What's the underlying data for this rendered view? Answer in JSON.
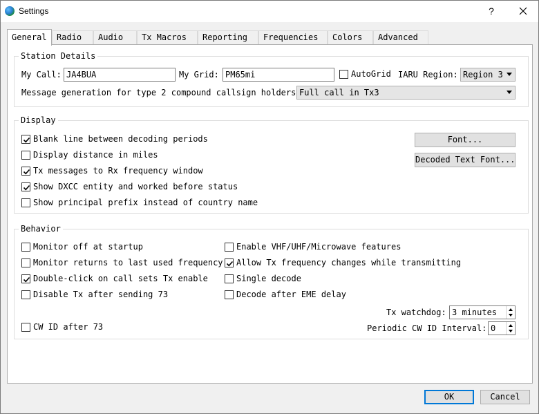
{
  "window": {
    "title": "Settings",
    "help_label": "?"
  },
  "tabs": [
    {
      "label": "General"
    },
    {
      "label": "Radio"
    },
    {
      "label": "Audio"
    },
    {
      "label": "Tx Macros"
    },
    {
      "label": "Reporting"
    },
    {
      "label": "Frequencies"
    },
    {
      "label": "Colors"
    },
    {
      "label": "Advanced"
    }
  ],
  "active_tab": "General",
  "station": {
    "title": "Station Details",
    "my_call_label": "My Call:",
    "my_call_value": "JA4BUA",
    "my_grid_label": "My Grid:",
    "my_grid_value": "PM65mi",
    "autogrid_label": "AutoGrid",
    "autogrid_checked": false,
    "iaru_label": "IARU Region:",
    "iaru_value": "Region 3",
    "msg_gen_label": "Message generation for type 2 compound callsign holders:",
    "msg_gen_value": "Full call in Tx3"
  },
  "display": {
    "title": "Display",
    "options": [
      {
        "label": "Blank line between decoding periods",
        "checked": true
      },
      {
        "label": "Display distance in miles",
        "checked": false
      },
      {
        "label": "Tx messages to Rx frequency window",
        "checked": true
      },
      {
        "label": "Show DXCC entity and worked before status",
        "checked": true
      },
      {
        "label": "Show principal prefix instead of country name",
        "checked": false
      }
    ],
    "font_button": "Font...",
    "decoded_font_button": "Decoded Text Font..."
  },
  "behavior": {
    "title": "Behavior",
    "left": [
      {
        "label": "Monitor off at startup",
        "checked": false
      },
      {
        "label": "Monitor returns to last used frequency",
        "checked": false
      },
      {
        "label": "Double-click on call sets Tx enable",
        "checked": true
      },
      {
        "label": "Disable Tx after sending 73",
        "checked": false
      }
    ],
    "right": [
      {
        "label": "Enable VHF/UHF/Microwave features",
        "checked": false
      },
      {
        "label": "Allow Tx frequency changes while transmitting",
        "checked": true
      },
      {
        "label": "Single decode",
        "checked": false
      },
      {
        "label": "Decode after EME delay",
        "checked": false
      }
    ],
    "cw_id": {
      "label": "CW ID after 73",
      "checked": false
    },
    "tx_watchdog_label": "Tx watchdog:",
    "tx_watchdog_value": "3 minutes",
    "cw_interval_label": "Periodic CW ID Interval:",
    "cw_interval_value": "0"
  },
  "footer": {
    "ok": "OK",
    "cancel": "Cancel"
  }
}
